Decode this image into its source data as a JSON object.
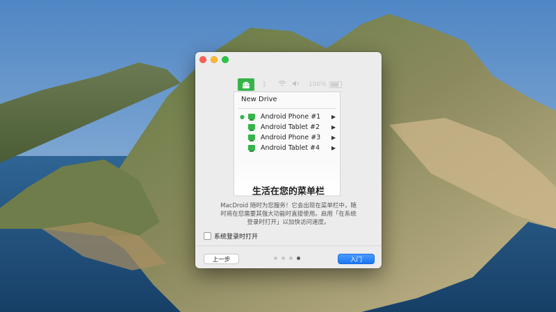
{
  "dialog": {
    "menubar_preview": {
      "app_icon": "android-icon",
      "status_icons": [
        "bluetooth-icon",
        "wifi-icon",
        "volume-icon"
      ],
      "battery_text": "100%"
    },
    "dropdown": {
      "header": "New Drive",
      "items": [
        {
          "label": "Android Phone #1",
          "selected": true
        },
        {
          "label": "Android Tablet #2",
          "selected": false
        },
        {
          "label": "Android Phone #3",
          "selected": false
        },
        {
          "label": "Android Tablet #4",
          "selected": false
        }
      ]
    },
    "title": "生活在您的菜单栏",
    "description": "MacDroid 随时为您服务！它会出现在菜单栏中，随时将在您需要其强大功能时直接使用。启用「在系统登录时打开」以加快访问速度。",
    "checkbox_label": "系统登录时打开",
    "back_button": "上一步",
    "next_button": "入门",
    "pager": {
      "total": 4,
      "current": 4
    }
  },
  "colors": {
    "accent": "#1a76f0",
    "android_green": "#35b44a"
  }
}
